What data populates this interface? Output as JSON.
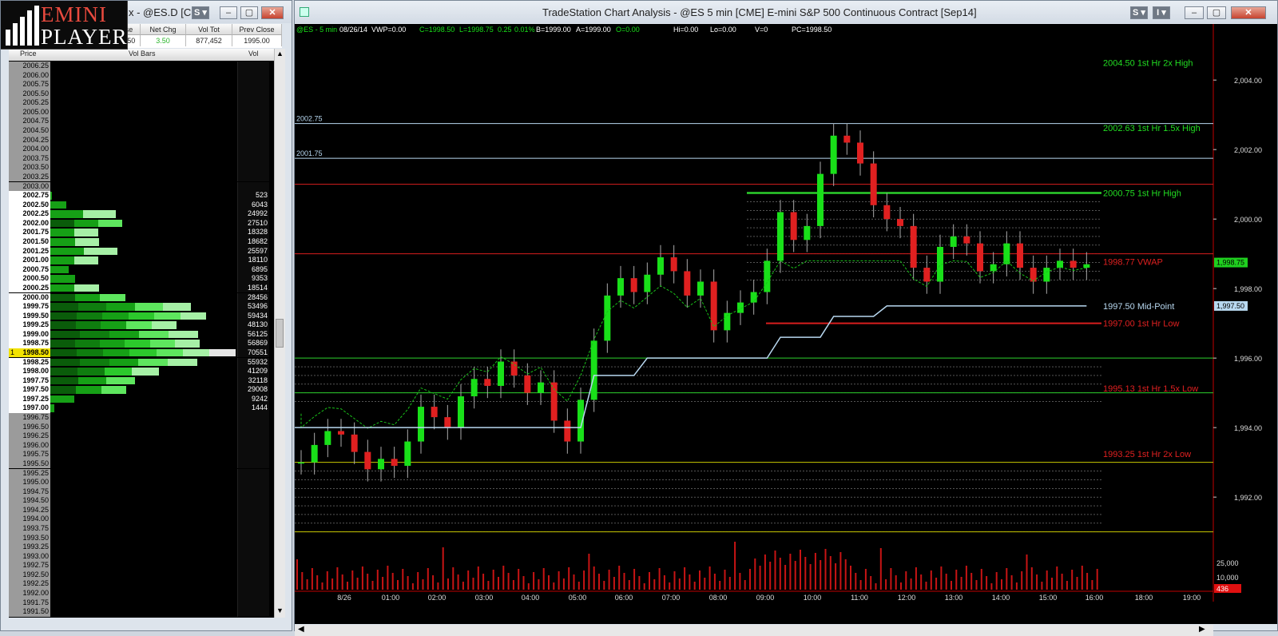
{
  "left_window": {
    "logo": {
      "word1": "EMINI",
      "word2": "PLAYER"
    },
    "title": "x - @ES.D [CM...",
    "quote": {
      "headers": [
        "lose",
        "Net Chg",
        "Vol Tot",
        "Prev Close"
      ],
      "values": [
        "98.50",
        "3.50",
        "877,452",
        "1995.00"
      ],
      "net_chg_color": "#2bb52b"
    },
    "ladder": {
      "headers": {
        "price": "Price",
        "bars": "Vol Bars",
        "vol": "Vol"
      },
      "current_price": "1998.50",
      "current_marker": "1",
      "rows": [
        {
          "price": "2006.25",
          "vol": ""
        },
        {
          "price": "2006.00",
          "vol": ""
        },
        {
          "price": "2005.75",
          "vol": ""
        },
        {
          "price": "2005.50",
          "vol": ""
        },
        {
          "price": "2005.25",
          "vol": ""
        },
        {
          "price": "2005.00",
          "vol": ""
        },
        {
          "price": "2004.75",
          "vol": ""
        },
        {
          "price": "2004.50",
          "vol": ""
        },
        {
          "price": "2004.25",
          "vol": ""
        },
        {
          "price": "2004.00",
          "vol": ""
        },
        {
          "price": "2003.75",
          "vol": ""
        },
        {
          "price": "2003.50",
          "vol": ""
        },
        {
          "price": "2003.25",
          "vol": ""
        },
        {
          "price": "2003.00",
          "vol": ""
        },
        {
          "price": "2002.75",
          "vol": "523"
        },
        {
          "price": "2002.50",
          "vol": "6043"
        },
        {
          "price": "2002.25",
          "vol": "24992"
        },
        {
          "price": "2002.00",
          "vol": "27510"
        },
        {
          "price": "2001.75",
          "vol": "18328"
        },
        {
          "price": "2001.50",
          "vol": "18682"
        },
        {
          "price": "2001.25",
          "vol": "25597"
        },
        {
          "price": "2001.00",
          "vol": "18110"
        },
        {
          "price": "2000.75",
          "vol": "6895"
        },
        {
          "price": "2000.50",
          "vol": "9353"
        },
        {
          "price": "2000.25",
          "vol": "18514"
        },
        {
          "price": "2000.00",
          "vol": "28456"
        },
        {
          "price": "1999.75",
          "vol": "53496"
        },
        {
          "price": "1999.50",
          "vol": "59434"
        },
        {
          "price": "1999.25",
          "vol": "48130"
        },
        {
          "price": "1999.00",
          "vol": "56125"
        },
        {
          "price": "1998.75",
          "vol": "56869"
        },
        {
          "price": "1998.50",
          "vol": "70551"
        },
        {
          "price": "1998.25",
          "vol": "55932"
        },
        {
          "price": "1998.00",
          "vol": "41209"
        },
        {
          "price": "1997.75",
          "vol": "32118"
        },
        {
          "price": "1997.50",
          "vol": "29008"
        },
        {
          "price": "1997.25",
          "vol": "9242"
        },
        {
          "price": "1997.00",
          "vol": "1444"
        },
        {
          "price": "1996.75",
          "vol": ""
        },
        {
          "price": "1996.50",
          "vol": ""
        },
        {
          "price": "1996.25",
          "vol": ""
        },
        {
          "price": "1996.00",
          "vol": ""
        },
        {
          "price": "1995.75",
          "vol": ""
        },
        {
          "price": "1995.50",
          "vol": ""
        },
        {
          "price": "1995.25",
          "vol": ""
        },
        {
          "price": "1995.00",
          "vol": ""
        },
        {
          "price": "1994.75",
          "vol": ""
        },
        {
          "price": "1994.50",
          "vol": ""
        },
        {
          "price": "1994.25",
          "vol": ""
        },
        {
          "price": "1994.00",
          "vol": ""
        },
        {
          "price": "1993.75",
          "vol": ""
        },
        {
          "price": "1993.50",
          "vol": ""
        },
        {
          "price": "1993.25",
          "vol": ""
        },
        {
          "price": "1993.00",
          "vol": ""
        },
        {
          "price": "1992.75",
          "vol": ""
        },
        {
          "price": "1992.50",
          "vol": ""
        },
        {
          "price": "1992.25",
          "vol": ""
        },
        {
          "price": "1992.00",
          "vol": ""
        },
        {
          "price": "1991.75",
          "vol": ""
        },
        {
          "price": "1991.50",
          "vol": ""
        }
      ]
    }
  },
  "chart_window": {
    "title": "TradeStation Chart Analysis - @ES 5 min [CME] E-mini S&P 500 Continuous Contract [Sep14]",
    "status_line": {
      "symbol": "@ES - 5 min",
      "date": "08/26/14",
      "vwp": "VWP=0.00",
      "close": "C=1998.50",
      "last": "L=1998.75",
      "chg": "0.25",
      "pct": "0.01%",
      "bid": "B=1999.00",
      "ask": "A=1999.00",
      "open": "O=0.00",
      "hi": "Hi=0.00",
      "lo": "Lo=0.00",
      "v": "V=0",
      "pc": "PC=1998.50"
    },
    "colors": {
      "up": "#19e019",
      "down": "#e02020",
      "line_blue": "#b8d8f0",
      "line_green": "#2cd02c",
      "line_red": "#d81e1e",
      "line_yellow": "#c8c800",
      "axis_red": "#c00000"
    }
  },
  "chart_data": {
    "type": "candlestick",
    "x_tick_labels": [
      "8/26",
      "01:00",
      "02:00",
      "03:00",
      "04:00",
      "05:00",
      "06:00",
      "07:00",
      "08:00",
      "09:00",
      "10:00",
      "11:00",
      "12:00",
      "13:00",
      "14:00",
      "15:00",
      "16:00",
      "18:00",
      "19:00"
    ],
    "y_tick_labels": [
      "2,004.00",
      "2,002.00",
      "2,000.00",
      "1,998.00",
      "1,996.00",
      "1,994.00",
      "1,992.00"
    ],
    "ylim": [
      1990.9,
      2005.2
    ],
    "volume_axis_labels": [
      "25,000",
      "10,000"
    ],
    "volume_last_label": "436",
    "last_price_label": "1,998.75",
    "midpoint_price_label": "1,997.50",
    "level_annotations": [
      {
        "text": "2004.50 1st Hr  2x High",
        "value": 2004.5,
        "color": "#22dd22"
      },
      {
        "text": "2002.63 1st Hr  1.5x High",
        "value": 2002.63,
        "color": "#22dd22"
      },
      {
        "text": "2000.75 1st Hr  High",
        "value": 2000.75,
        "color": "#22dd22"
      },
      {
        "text": "1998.77 VWAP",
        "value": 1998.77,
        "color": "#e02020"
      },
      {
        "text": "1997.50 Mid-Point",
        "value": 1997.5,
        "color": "#b8d8f0"
      },
      {
        "text": "1997.00 1st Hr  Low",
        "value": 1997.0,
        "color": "#e02020"
      },
      {
        "text": "1995.13 1st Hr  1.5x Low",
        "value": 1995.13,
        "color": "#e02020"
      },
      {
        "text": "1993.25 1st Hr  2x Low",
        "value": 1993.25,
        "color": "#e02020"
      }
    ],
    "line_labels": [
      {
        "text": "2002.75",
        "value": 2002.75
      },
      {
        "text": "2001.75",
        "value": 2001.75
      }
    ],
    "horizontal_lines": [
      {
        "value": 2002.75,
        "color": "#b8d8f0"
      },
      {
        "value": 2001.75,
        "color": "#b8d8f0"
      },
      {
        "value": 2001.0,
        "color": "#d81e1e"
      },
      {
        "value": 1999.0,
        "color": "#d81e1e"
      },
      {
        "value": 1996.0,
        "color": "#2cd02c"
      },
      {
        "value": 1995.0,
        "color": "#2cd02c"
      },
      {
        "value": 1993.0,
        "color": "#c8c800"
      },
      {
        "value": 1991.0,
        "color": "#c8c800"
      }
    ],
    "close_series_sample": [
      1993.0,
      1993.5,
      1993.9,
      1993.8,
      1993.3,
      1992.8,
      1993.1,
      1992.9,
      1993.6,
      1994.6,
      1994.3,
      1994.0,
      1994.9,
      1995.4,
      1995.2,
      1995.9,
      1995.5,
      1995.0,
      1995.3,
      1994.2,
      1993.6,
      1994.8,
      1996.5,
      1997.8,
      1998.3,
      1997.9,
      1998.4,
      1998.9,
      1998.5,
      1997.8,
      1998.2,
      1996.8,
      1997.3,
      1997.6,
      1997.9,
      1998.8,
      2000.2,
      1999.4,
      1999.8,
      2001.3,
      2002.4,
      2002.2,
      2001.6,
      2000.4,
      2000.0,
      1999.8,
      1998.6,
      1998.2,
      1999.2,
      1999.5,
      1999.3,
      1998.5,
      1998.7,
      1999.3,
      1998.6,
      1998.2,
      1998.6,
      1998.8,
      1998.6,
      1998.7
    ]
  }
}
